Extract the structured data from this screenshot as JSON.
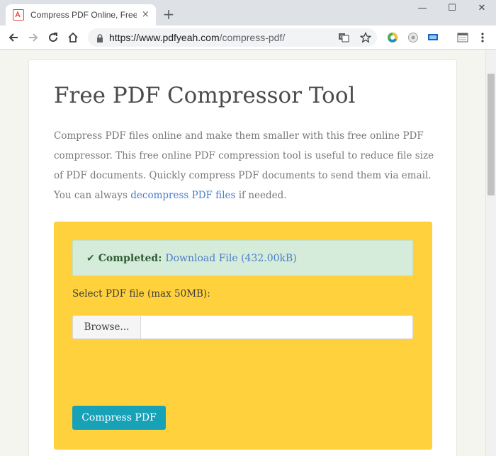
{
  "browser": {
    "tab_title": "Compress PDF Online, Free PDF",
    "tab_close": "×",
    "new_tab": "+",
    "window_minimize": "—",
    "window_maximize": "☐",
    "window_close": "✕",
    "url_host": "https://www.pdfyeah.com",
    "url_path": "/compress-pdf/",
    "icons": [
      "back-icon",
      "forward-icon",
      "reload-icon",
      "home-icon",
      "lock-icon",
      "translate-icon",
      "star-icon",
      "extension-icon",
      "menu-icon"
    ]
  },
  "page": {
    "title": "Free PDF Compressor Tool",
    "intro_text": "Compress PDF files online and make them smaller with this free online PDF compressor. This free online PDF compression tool is useful to reduce file size of PDF documents. Quickly compress PDF documents to send them via email. You can always ",
    "intro_link": "decompress PDF files",
    "intro_after": " if needed.",
    "status": {
      "label": "Completed:",
      "link": "Download File (432.00kB)"
    },
    "file_label": "Select PDF file (max 50MB):",
    "browse_label": "Browse...",
    "file_value": "",
    "compress_label": "Compress PDF"
  },
  "colors": {
    "panel": "#ffd13c",
    "alert_bg": "#d6ecda",
    "link": "#4a7dcc",
    "button": "#17a2b8"
  }
}
